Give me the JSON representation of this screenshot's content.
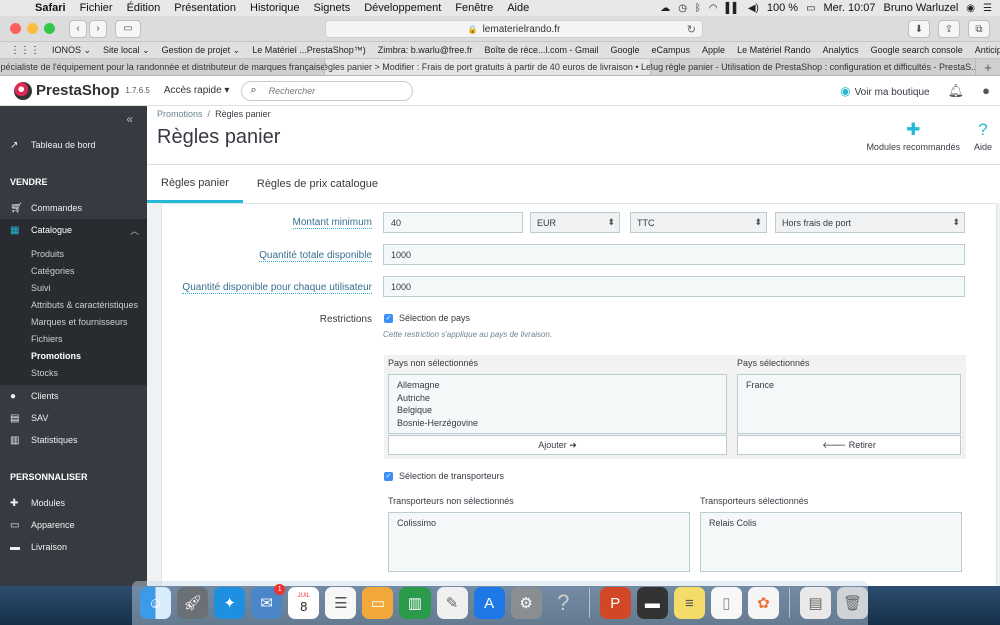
{
  "menubar": {
    "app": "Safari",
    "items": [
      "Fichier",
      "Édition",
      "Présentation",
      "Historique",
      "Signets",
      "Développement",
      "Fenêtre",
      "Aide"
    ],
    "battery": "100 %",
    "datetime": "Mer. 10:07",
    "user": "Bruno Warluzel"
  },
  "browser": {
    "url": "lematerielrando.fr",
    "bookmarks": [
      "IONOS ⌄",
      "Site local ⌄",
      "Gestion de projet ⌄",
      "Le Matériel ...PrestaShop™)",
      "Zimbra: b.warlu@free.fr",
      "Boîte de réce...l.com - Gmail",
      "Google",
      "eCampus",
      "Apple",
      "Le Matériel Rando",
      "Analytics",
      "Google search console",
      "Anticiper le ...te Prestashop"
    ],
    "tabs": [
      "Spécialiste de l'équipement pour la randonnée et distributeur de marques françaises",
      "Règles panier > Modifier : Frais de port gratuits à partir de 40 euros de livraison • Le...",
      "Bug règle panier - Utilisation de PrestaShop : configuration et difficultés - PrestaS..."
    ]
  },
  "header": {
    "logo": "PrestaShop",
    "version": "1.7.6.5",
    "quick_access": "Accès rapide ▾",
    "search_placeholder": "Rechercher",
    "view_shop": "Voir ma boutique"
  },
  "sidebar": {
    "dashboard": "Tableau de bord",
    "section_sell": "VENDRE",
    "orders": "Commandes",
    "catalog": "Catalogue",
    "catalog_sub": [
      "Produits",
      "Catégories",
      "Suivi",
      "Attributs & caractéristiques",
      "Marques et fournisseurs",
      "Fichiers",
      "Promotions",
      "Stocks"
    ],
    "customers": "Clients",
    "sav": "SAV",
    "stats": "Statistiques",
    "section_custom": "PERSONNALISER",
    "modules": "Modules",
    "appearance": "Apparence",
    "shipping": "Livraison"
  },
  "page": {
    "breadcrumb_parent": "Promotions",
    "breadcrumb_sep": "/",
    "breadcrumb_current": "Règles panier",
    "title": "Règles panier",
    "btn_modules": "Modules recommandés",
    "btn_help": "Aide",
    "tabs": [
      "Règles panier",
      "Règles de prix catalogue"
    ]
  },
  "form": {
    "min_amount_label": "Montant minimum",
    "min_amount_value": "40",
    "currency": "EUR",
    "tax": "TTC",
    "shipping": "Hors frais de port",
    "total_qty_label": "Quantité totale disponible",
    "total_qty_value": "1000",
    "user_qty_label": "Quantité disponible pour chaque utilisateur",
    "user_qty_value": "1000",
    "restrictions_label": "Restrictions",
    "country_cb": "Sélection de pays",
    "country_note": "Cette restriction s'applique au pays de livraison.",
    "countries_unselected_title": "Pays non sélectionnés",
    "countries_unselected": [
      "Allemagne",
      "Autriche",
      "Belgique",
      "Bosnie-Herzégovine"
    ],
    "countries_selected_title": "Pays sélectionnés",
    "countries_selected": [
      "France"
    ],
    "add_btn": "Ajouter ➔",
    "remove_btn": "🡐 Retirer",
    "carrier_cb": "Sélection de transporteurs",
    "carriers_unselected_title": "Transporteurs non sélectionnés",
    "carriers_unselected": [
      "Colissimo"
    ],
    "carriers_selected_title": "Transporteurs sélectionnés",
    "carriers_selected": [
      "Relais Colis"
    ]
  },
  "dock": {
    "calendar_day": "8",
    "calendar_month": "JUIL",
    "mail_badge": "1"
  }
}
